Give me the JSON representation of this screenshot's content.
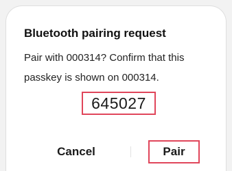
{
  "dialog": {
    "title": "Bluetooth pairing request",
    "message": "Pair with 000314? Confirm that this passkey is shown on 000314.",
    "passkey": "645027"
  },
  "actions": {
    "cancel_label": "Cancel",
    "pair_label": "Pair"
  },
  "colors": {
    "highlight_border": "#e0455a",
    "dialog_background": "#ffffff",
    "page_background": "#f2f2f2"
  }
}
